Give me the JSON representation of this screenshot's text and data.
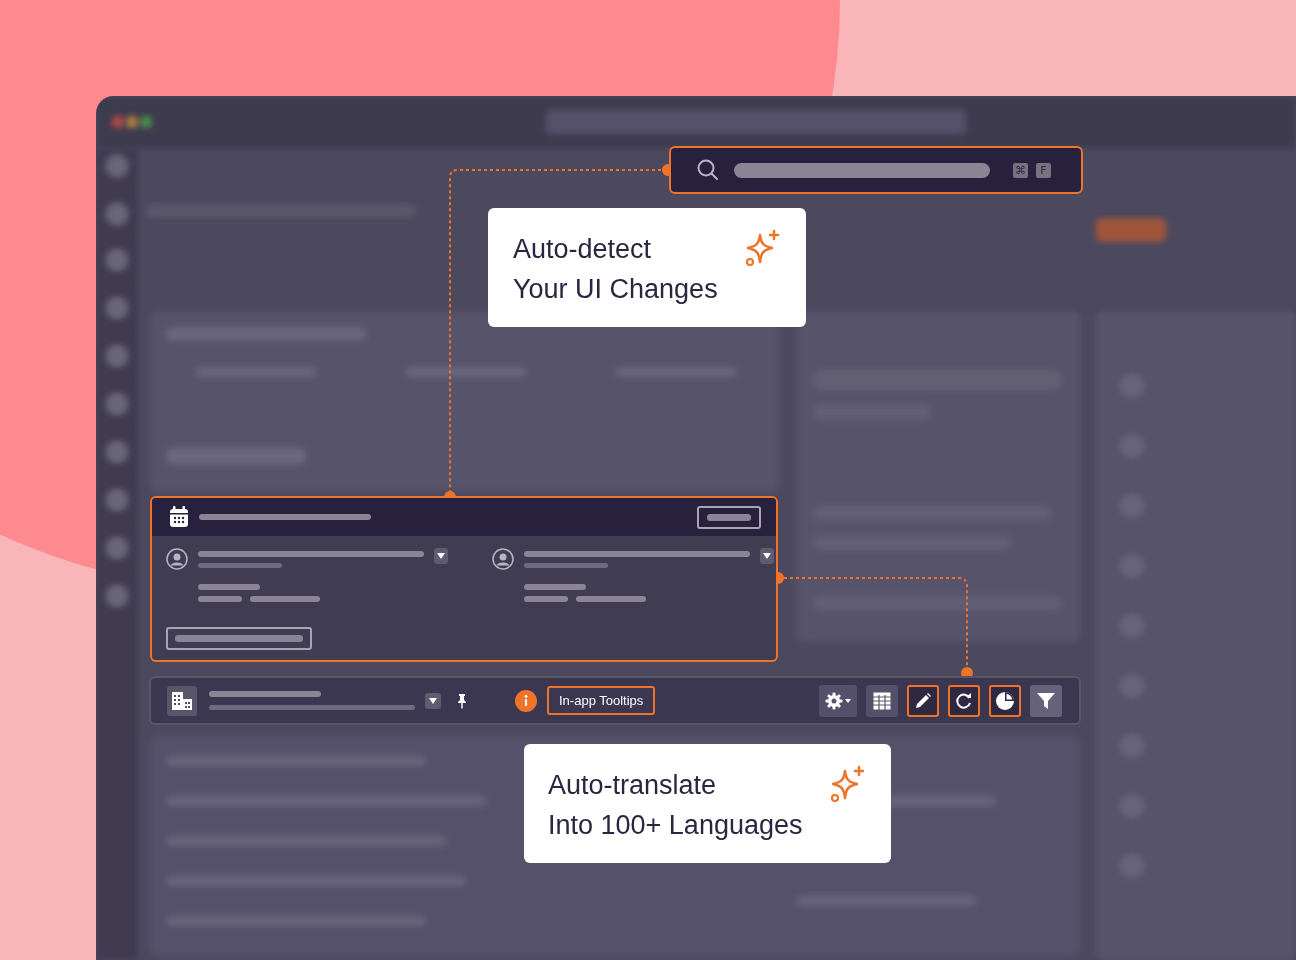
{
  "search": {
    "keys": [
      "⌘",
      "F"
    ]
  },
  "callouts": [
    {
      "lines": [
        "Auto-detect",
        "Your UI Changes"
      ]
    },
    {
      "lines": [
        "Auto-translate",
        "Into 100+ Languages"
      ]
    }
  ],
  "card": {
    "people": [
      {
        "expanded": false
      },
      {
        "expanded": false
      }
    ]
  },
  "toolbar": {
    "tag": "In-app Tooltips",
    "tools": [
      {
        "kind": "gear",
        "highlighted": false
      },
      {
        "kind": "table",
        "highlighted": false
      },
      {
        "kind": "pencil",
        "highlighted": true
      },
      {
        "kind": "refresh",
        "highlighted": true
      },
      {
        "kind": "pie",
        "highlighted": true
      },
      {
        "kind": "filter",
        "highlighted": false
      }
    ]
  }
}
